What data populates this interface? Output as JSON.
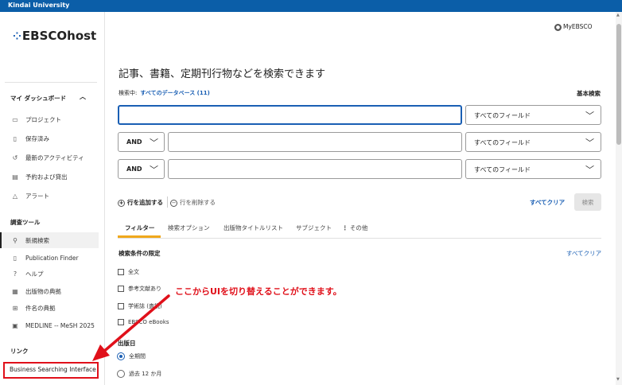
{
  "topbar": {
    "institution": "Kindai University"
  },
  "sidebar": {
    "logo_text": "EBSCOhost",
    "logo_mark": "⁘",
    "dashboard_heading": "マイ ダッシュボード",
    "dashboard_items": [
      {
        "label": "プロジェクト",
        "icon": "folder-icon",
        "glyph": "▭"
      },
      {
        "label": "保存済み",
        "icon": "bookmark-icon",
        "glyph": "▯"
      },
      {
        "label": "最新のアクティビティ",
        "icon": "history-icon",
        "glyph": "↺"
      },
      {
        "label": "予約および貸出",
        "icon": "book-icon",
        "glyph": "▤"
      },
      {
        "label": "アラート",
        "icon": "bell-icon",
        "glyph": "△"
      }
    ],
    "research_heading": "調査ツール",
    "research_items": [
      {
        "label": "新規検索",
        "icon": "search-icon",
        "glyph": "⚲"
      },
      {
        "label": "Publication Finder",
        "icon": "document-icon",
        "glyph": "▯"
      },
      {
        "label": "ヘルプ",
        "icon": "help-icon",
        "glyph": "?"
      },
      {
        "label": "出版物の典拠",
        "icon": "publication-icon",
        "glyph": "▦"
      },
      {
        "label": "件名の典拠",
        "icon": "hierarchy-icon",
        "glyph": "⊞"
      },
      {
        "label": "MEDLINE -- MeSH 2025",
        "icon": "mesh-icon",
        "glyph": "▣"
      }
    ],
    "links_heading": "リンク",
    "business_link": "Business Searching Interface"
  },
  "header": {
    "myebsco": "MyEBSCO"
  },
  "main": {
    "title": "記事、書籍、定期刊行物などを検索できます",
    "searching_label": "検索中:",
    "searching_value": "すべてのデータベース (11)",
    "basic_search": "基本検索",
    "field_select": "すべてのフィールド",
    "operator": "AND",
    "add_row": "行を追加する",
    "remove_row": "行を削除する",
    "clear_all": "すべてクリア",
    "search_button": "検索"
  },
  "tabs": [
    "フィルター",
    "検索オプション",
    "出版物タイトルリスト",
    "サブジェクト",
    "その他"
  ],
  "filters": {
    "heading": "検索条件の限定",
    "clear": "すべてクリア",
    "checkboxes": [
      "全文",
      "参考文献あり",
      "学術誌 (査読)",
      "EBSCO eBooks"
    ],
    "pubdate_heading": "出版日",
    "radios": [
      "全期間",
      "過去 12 か月"
    ]
  },
  "annotation": "ここからUIを切り替えることができます。",
  "colors": {
    "brand": "#0b5ea8",
    "link": "#1a5fb4",
    "accent": "#f0a81c",
    "annotation": "#e0101a"
  }
}
